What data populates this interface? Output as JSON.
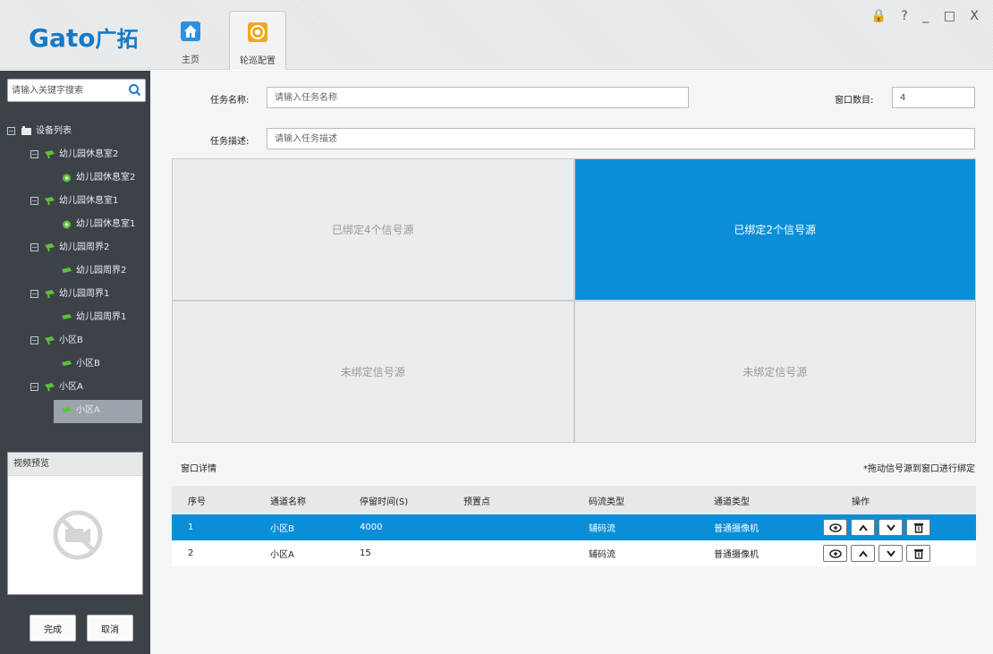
{
  "app": {
    "logo_latin": "Gato",
    "logo_cn": "广拓",
    "window_controls": "🔒 ? _ □ X"
  },
  "nav": {
    "tabs": [
      {
        "label": "主页",
        "icon": "home-icon",
        "color": "#2f8fe0"
      },
      {
        "label": "轮巡配置",
        "icon": "patrol-config-icon",
        "color": "#f2a81c"
      }
    ]
  },
  "sidebar": {
    "search_placeholder": "请输入关键字搜索",
    "tree": [
      {
        "label": "设备列表",
        "level": 0,
        "toggle": "⊟"
      },
      {
        "label": "幼儿园休息室2",
        "level": 1,
        "toggle": "⊟"
      },
      {
        "label": "幼儿园休息室2",
        "level": 2
      },
      {
        "label": "幼儿园休息室1",
        "level": 1,
        "toggle": "⊟"
      },
      {
        "label": "幼儿园休息室1",
        "level": 2
      },
      {
        "label": "幼儿园周界2",
        "level": 1,
        "toggle": "⊟"
      },
      {
        "label": "幼儿园周界2",
        "level": 2
      },
      {
        "label": "幼儿园周界1",
        "level": 1,
        "toggle": "⊟"
      },
      {
        "label": "幼儿园周界1",
        "level": 2
      },
      {
        "label": "小区B",
        "level": 1,
        "toggle": "⊟"
      },
      {
        "label": "小区B",
        "level": 2
      },
      {
        "label": "小区A",
        "level": 1,
        "toggle": "⊟"
      },
      {
        "label": "小区A",
        "level": 2,
        "selected": true
      }
    ],
    "preview_title": "视频预览",
    "done_label": "完成",
    "cancel_label": "取消"
  },
  "form": {
    "task_name_label": "任务名称:",
    "task_name_placeholder": "请输入任务名称",
    "window_count_label": "窗口数目:",
    "window_count_value": "4",
    "task_desc_label": "任务描述:",
    "task_desc_placeholder": "请输入任务描述"
  },
  "grid": {
    "cells": [
      {
        "text": "已绑定4个信号源",
        "active": false
      },
      {
        "text": "已绑定2个信号源",
        "active": true
      },
      {
        "text": "未绑定信号源",
        "active": false
      },
      {
        "text": "未绑定信号源",
        "active": false
      }
    ]
  },
  "details": {
    "title": "窗口详情",
    "hint": "*拖动信号源到窗口进行绑定",
    "columns": [
      "序号",
      "通道名称",
      "停留时间(S)",
      "预置点",
      "码流类型",
      "通道类型",
      "操作"
    ],
    "rows": [
      {
        "index": "1",
        "channel": "小区B",
        "stay": "4000",
        "preset": "",
        "stream": "辅码流",
        "type": "普通摄像机",
        "selected": true
      },
      {
        "index": "2",
        "channel": "小区A",
        "stay": "15",
        "preset": "",
        "stream": "辅码流",
        "type": "普通摄像机",
        "selected": false
      }
    ],
    "ops": [
      "view-icon",
      "move-up-icon",
      "move-down-icon",
      "delete-icon"
    ]
  },
  "colors": {
    "accent": "#0b8ed8",
    "sidebar_bg": "#3d4249",
    "logo": "#1679c6",
    "camera_green": "#5cc23a"
  }
}
